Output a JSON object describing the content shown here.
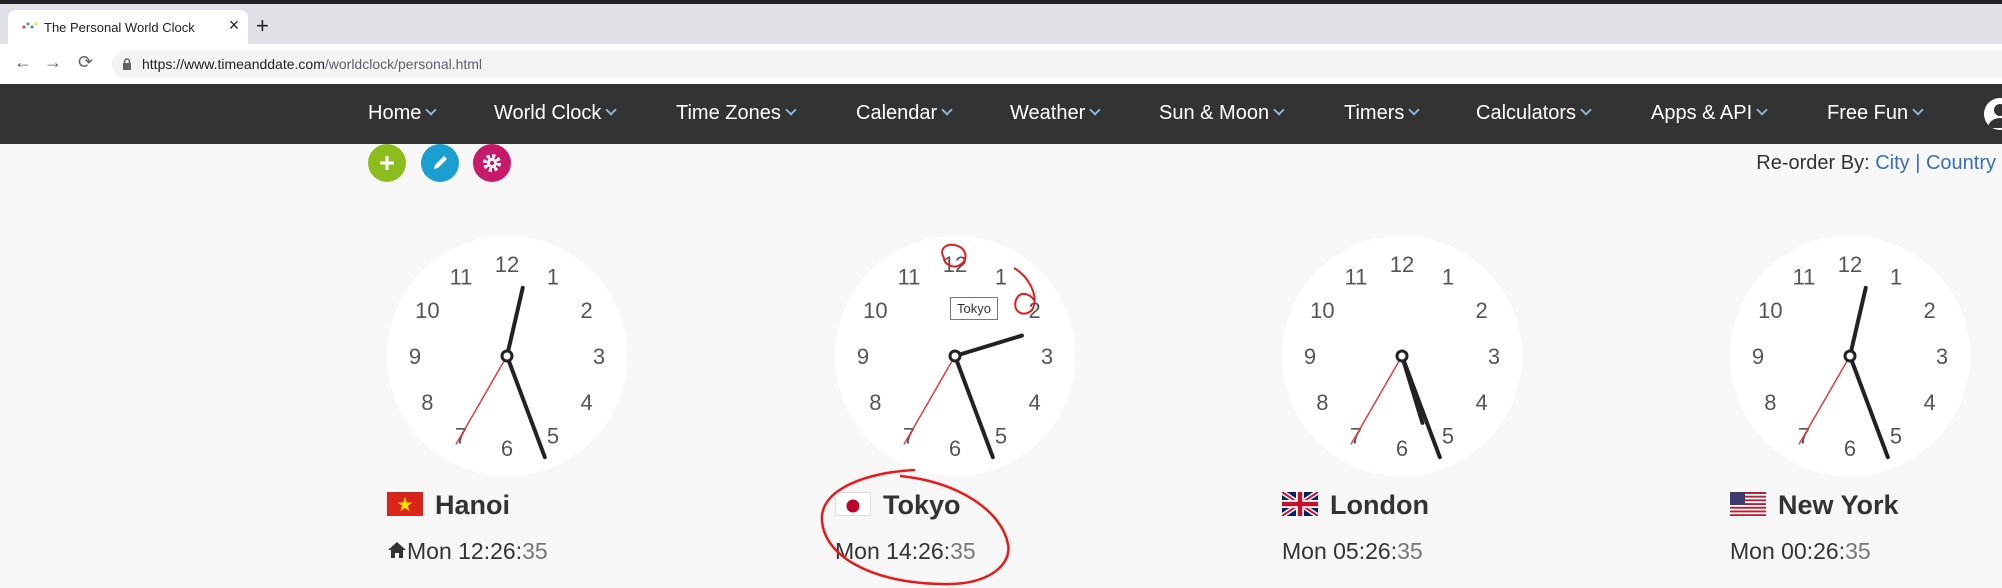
{
  "browser": {
    "tab_title": "The Personal World Clock",
    "close_glyph": "×",
    "new_tab_glyph": "+",
    "url_domain": "https://www.timeanddate.com",
    "url_path": "/worldclock/personal.html",
    "back_glyph": "←",
    "forward_glyph": "→",
    "reload_glyph": "⟳"
  },
  "nav": {
    "items": [
      {
        "label": "Home"
      },
      {
        "label": "World Clock"
      },
      {
        "label": "Time Zones"
      },
      {
        "label": "Calendar"
      },
      {
        "label": "Weather"
      },
      {
        "label": "Sun & Moon"
      },
      {
        "label": "Timers"
      },
      {
        "label": "Calculators"
      },
      {
        "label": "Apps & API"
      },
      {
        "label": "Free Fun"
      }
    ]
  },
  "actions": {
    "add_icon": "plus-icon",
    "edit_icon": "pencil-icon",
    "settings_icon": "gear-icon",
    "add_color": "#8bbd1d",
    "edit_color": "#1a9fd0",
    "settings_color": "#c81a6a"
  },
  "reorder": {
    "label": "Re-order By:",
    "city": "City",
    "separator": "|",
    "country": "Country"
  },
  "clock_numbers": [
    "12",
    "1",
    "2",
    "3",
    "4",
    "5",
    "6",
    "7",
    "8",
    "9",
    "10",
    "11"
  ],
  "clocks": [
    {
      "city": "Hanoi",
      "day": "Mon",
      "hm": "12:26:",
      "sec": "35",
      "home": true,
      "flag": "vietnam-flag",
      "hour": 12,
      "minute": 26,
      "second": 35
    },
    {
      "city": "Tokyo",
      "day": "Mon",
      "hm": "14:26:",
      "sec": "35",
      "home": false,
      "flag": "japan-flag",
      "hour": 14,
      "minute": 26,
      "second": 35
    },
    {
      "city": "London",
      "day": "Mon",
      "hm": "05:26:",
      "sec": "35",
      "home": false,
      "flag": "uk-flag",
      "hour": 5,
      "minute": 26,
      "second": 35
    },
    {
      "city": "New York",
      "day": "Mon",
      "hm": "00:26:",
      "sec": "35",
      "home": false,
      "flag": "usa-flag",
      "hour": 0,
      "minute": 26,
      "second": 35
    }
  ],
  "tooltip": "Tokyo"
}
